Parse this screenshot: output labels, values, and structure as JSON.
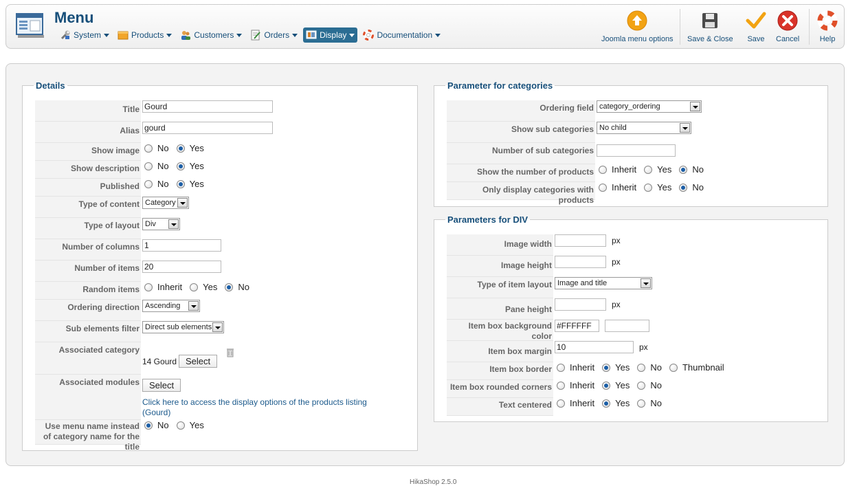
{
  "header": {
    "title": "Menu"
  },
  "menubar": [
    {
      "label": "System",
      "icon": "wrench-icon"
    },
    {
      "label": "Products",
      "icon": "box-icon"
    },
    {
      "label": "Customers",
      "icon": "users-icon"
    },
    {
      "label": "Orders",
      "icon": "document-icon"
    },
    {
      "label": "Display",
      "icon": "display-icon",
      "active": true
    },
    {
      "label": "Documentation",
      "icon": "lifebuoy-icon"
    }
  ],
  "toolbar": {
    "joomla_options": "Joomla menu options",
    "save_close": "Save & Close",
    "save": "Save",
    "cancel": "Cancel",
    "help": "Help"
  },
  "details": {
    "legend": "Details",
    "title_label": "Title",
    "title_value": "Gourd",
    "alias_label": "Alias",
    "alias_value": "gourd",
    "show_image_label": "Show image",
    "show_description_label": "Show description",
    "published_label": "Published",
    "no": "No",
    "yes": "Yes",
    "inherit": "Inherit",
    "type_content_label": "Type of content",
    "type_content_value": "Category",
    "type_layout_label": "Type of layout",
    "type_layout_value": "Div",
    "num_columns_label": "Number of columns",
    "num_columns_value": "1",
    "num_items_label": "Number of items",
    "num_items_value": "20",
    "random_items_label": "Random items",
    "ordering_direction_label": "Ordering direction",
    "ordering_direction_value": "Ascending",
    "sub_filter_label": "Sub elements filter",
    "sub_filter_value": "Direct sub elements",
    "assoc_category_label": "Associated category",
    "assoc_category_value": "14 Gourd",
    "select_label": "Select",
    "assoc_modules_label": "Associated modules",
    "link_text": "Click here to access the display options of the products listing (Gourd)",
    "use_menu_name_label": "Use menu name instead of category name for the title"
  },
  "categories": {
    "legend": "Parameter for categories",
    "ordering_field_label": "Ordering field",
    "ordering_field_value": "category_ordering",
    "show_sub_label": "Show sub categories",
    "show_sub_value": "No child",
    "num_sub_label": "Number of sub categories",
    "num_sub_value": "",
    "show_num_products_label": "Show the number of products",
    "only_display_label": "Only display categories with products"
  },
  "div": {
    "legend": "Parameters for DIV",
    "image_width_label": "Image width",
    "image_width_value": "",
    "image_height_label": "Image height",
    "image_height_value": "",
    "item_layout_label": "Type of item layout",
    "item_layout_value": "Image and title",
    "pane_height_label": "Pane height",
    "pane_height_value": "",
    "bg_color_label": "Item box background color",
    "bg_color_value": "#FFFFFF",
    "margin_label": "Item box margin",
    "margin_value": "10",
    "border_label": "Item box border",
    "rounded_label": "Item box rounded corners",
    "text_centered_label": "Text centered",
    "thumbnail": "Thumbnail",
    "px": "px"
  },
  "footer": {
    "text": "HikaShop 2.5.0"
  },
  "colors": {
    "accent": "#174f7a",
    "active_menu": "#2b6d93",
    "cancel_red": "#d9332a",
    "save_orange": "#f0a312"
  }
}
